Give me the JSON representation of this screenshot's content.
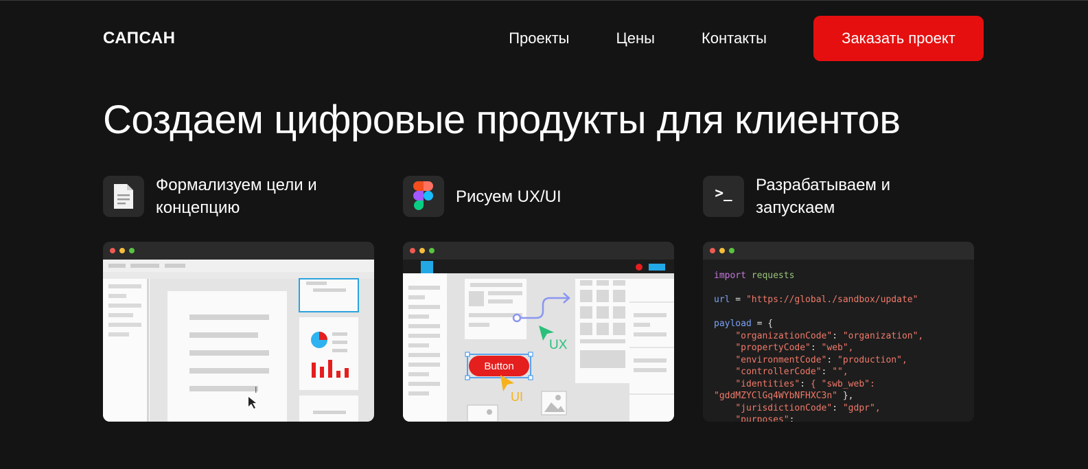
{
  "header": {
    "logo": "САПСАН",
    "nav": [
      "Проекты",
      "Цены",
      "Контакты"
    ],
    "cta_label": "Заказать проект"
  },
  "hero": {
    "title": "Создаем цифровые продукты для клиентов"
  },
  "cards": [
    {
      "title_line1": "Формализуем цели и",
      "title_line2": "концепцию",
      "icon": "document-icon"
    },
    {
      "title": "Рисуем UX/UI",
      "icon": "figma-icon",
      "button_label": "Button",
      "ux_label": "UX",
      "ui_label": "UI"
    },
    {
      "title_line1": "Разрабатываем и",
      "title_line2": "запускаем",
      "icon": "terminal-icon",
      "icon_text": ">_"
    }
  ],
  "code": {
    "line1_kw": "import",
    "line1_mod": "requests",
    "line2_var": "url",
    "line2_eq": " = ",
    "line2_str": "\"https://global./sandbox/update\"",
    "line3_var": "payload",
    "line3_rest": " = {",
    "entries": [
      [
        "\"organizationCode\"",
        "\"organization\","
      ],
      [
        "\"propertyCode\"",
        "\"web\","
      ],
      [
        "\"environmentCode\"",
        "\"production\","
      ],
      [
        "\"controllerCode\"",
        "\"\","
      ],
      [
        "\"identities\"",
        "{ \"swb_web\":"
      ]
    ],
    "wrap_line": "\"gddMZYClGq4WYbNFHXC3n\"",
    "wrap_tail": " },",
    "entries2": [
      [
        "\"jurisdictionCode\"",
        "\"gdpr\","
      ],
      [
        "\"purposes\"",
        ""
      ]
    ]
  },
  "colors": {
    "accent": "#e50f0f",
    "background": "#141414",
    "card": "#2a2a2a"
  }
}
